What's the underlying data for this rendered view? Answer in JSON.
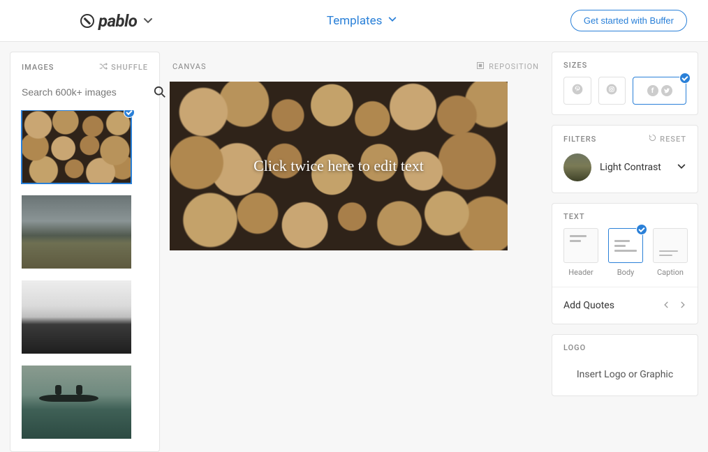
{
  "header": {
    "brand": "pablo",
    "templates_label": "Templates",
    "cta_label": "Get started with Buffer"
  },
  "sidebar_left": {
    "title": "IMAGES",
    "shuffle_label": "SHUFFLE",
    "search_placeholder": "Search 600k+ images"
  },
  "center": {
    "canvas_label": "CANVAS",
    "reposition_label": "REPOSITION",
    "canvas_text": "Click twice here to edit text"
  },
  "sidebar_right": {
    "sizes": {
      "title": "SIZES"
    },
    "filters": {
      "title": "FILTERS",
      "reset_label": "RESET",
      "selected": "Light Contrast"
    },
    "text": {
      "title": "TEXT",
      "options": [
        "Header",
        "Body",
        "Caption"
      ],
      "quotes_label": "Add Quotes"
    },
    "logo": {
      "title": "LOGO",
      "insert_label": "Insert Logo or Graphic"
    }
  }
}
